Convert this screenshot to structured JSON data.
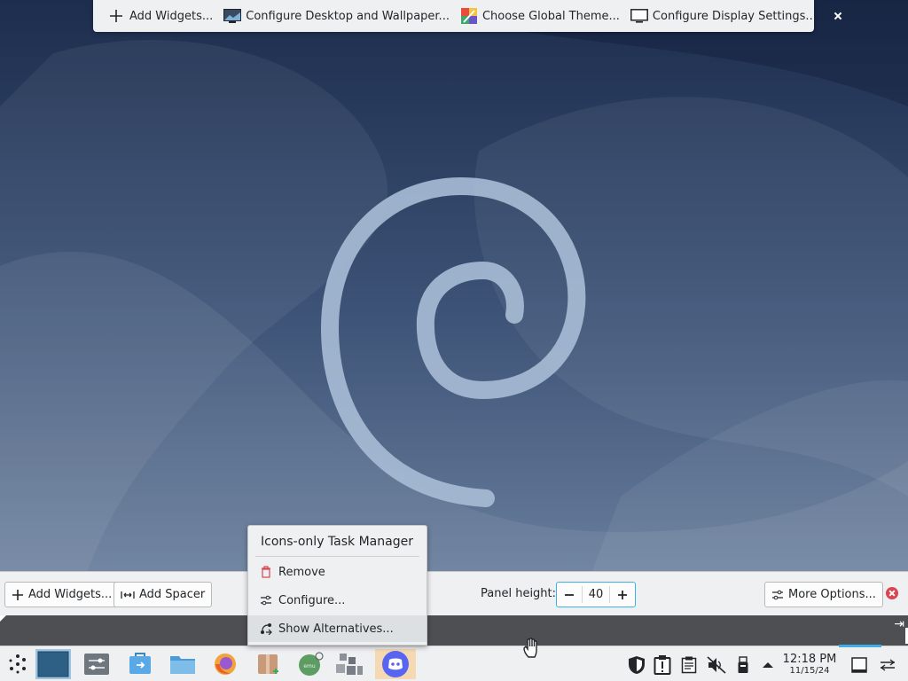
{
  "top_toolbar": {
    "items": [
      {
        "label": "Add Widgets...",
        "icon": "plus-icon"
      },
      {
        "label": "Configure Desktop and Wallpaper...",
        "icon": "wallpaper-icon"
      },
      {
        "label": "Choose Global Theme...",
        "icon": "theme-icon"
      },
      {
        "label": "Configure Display Settings...",
        "icon": "display-icon"
      }
    ]
  },
  "panel_edit": {
    "add_widgets": "Add Widgets...",
    "add_spacer": "Add Spacer",
    "panel_height_label": "Panel height:",
    "panel_height_value": "40",
    "more_options": "More Options..."
  },
  "context_menu": {
    "title": "Icons-only Task Manager",
    "items": [
      {
        "label": "Remove",
        "icon": "trash-icon"
      },
      {
        "label": "Configure...",
        "icon": "configure-icon"
      },
      {
        "label": "Show Alternatives...",
        "icon": "alternatives-icon"
      }
    ]
  },
  "taskbar": {
    "apps": [
      "application-launcher",
      "pager",
      "system-settings",
      "discover",
      "file-manager",
      "firefox",
      "archive-manager",
      "emulator",
      "settings-group",
      "discord"
    ]
  },
  "tray": {
    "clock_time": "12:18 PM",
    "clock_date": "11/15/24"
  },
  "colors": {
    "accent": "#3daee9",
    "close": "#da4453",
    "panel_bg": "#eff0f1",
    "wallpaper_dark": "#1e2e4e",
    "wallpaper_light": "#7e92ad"
  }
}
